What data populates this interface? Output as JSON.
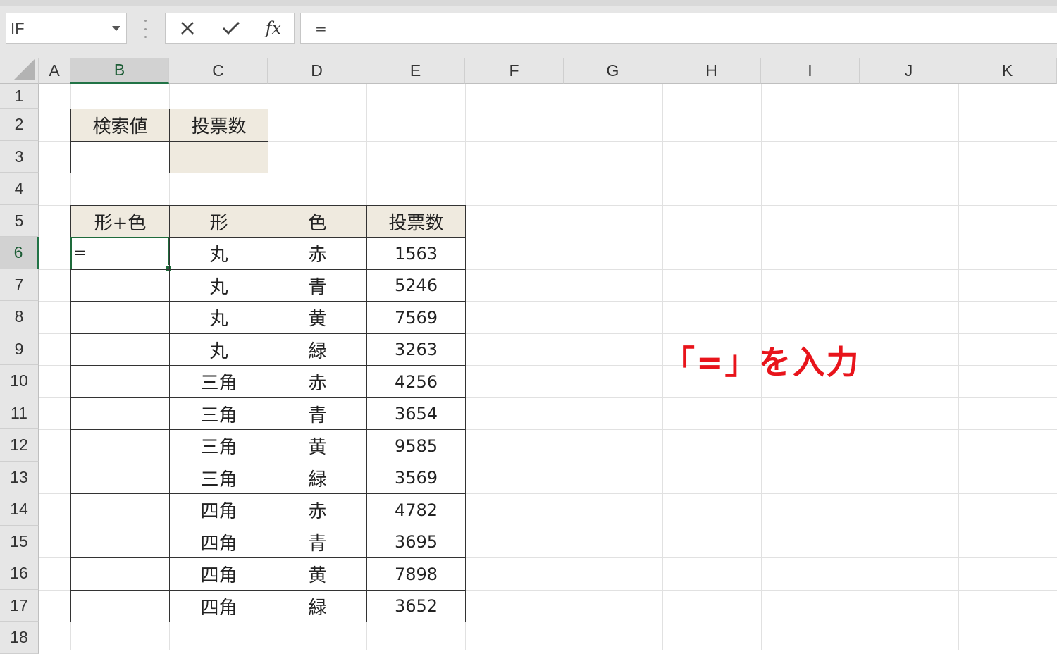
{
  "formula_bar": {
    "name_box": "IF",
    "cancel_icon": "close-icon",
    "enter_icon": "check-icon",
    "fx_label": "fx",
    "formula": "="
  },
  "columns": [
    "A",
    "B",
    "C",
    "D",
    "E",
    "F",
    "G",
    "H",
    "I",
    "J",
    "K"
  ],
  "selected_column": "B",
  "rows": [
    "1",
    "2",
    "3",
    "4",
    "5",
    "6",
    "7",
    "8",
    "9",
    "10",
    "11",
    "12",
    "13",
    "14",
    "15",
    "16",
    "17",
    "18"
  ],
  "selected_row": "6",
  "lookup_table": {
    "headers": [
      "検索値",
      "投票数"
    ],
    "values": [
      "",
      ""
    ]
  },
  "data_table": {
    "headers": [
      "形+色",
      "形",
      "色",
      "投票数"
    ],
    "rows": [
      [
        "=",
        "丸",
        "赤",
        "1563"
      ],
      [
        "",
        "丸",
        "青",
        "5246"
      ],
      [
        "",
        "丸",
        "黄",
        "7569"
      ],
      [
        "",
        "丸",
        "緑",
        "3263"
      ],
      [
        "",
        "三角",
        "赤",
        "4256"
      ],
      [
        "",
        "三角",
        "青",
        "3654"
      ],
      [
        "",
        "三角",
        "黄",
        "9585"
      ],
      [
        "",
        "三角",
        "緑",
        "3569"
      ],
      [
        "",
        "四角",
        "赤",
        "4782"
      ],
      [
        "",
        "四角",
        "青",
        "3695"
      ],
      [
        "",
        "四角",
        "黄",
        "7898"
      ],
      [
        "",
        "四角",
        "緑",
        "3652"
      ]
    ]
  },
  "annotation": "「=」を入力",
  "colors": {
    "accent": "#217346",
    "header_fill": "#efeadf",
    "annotation": "#e8141b"
  }
}
